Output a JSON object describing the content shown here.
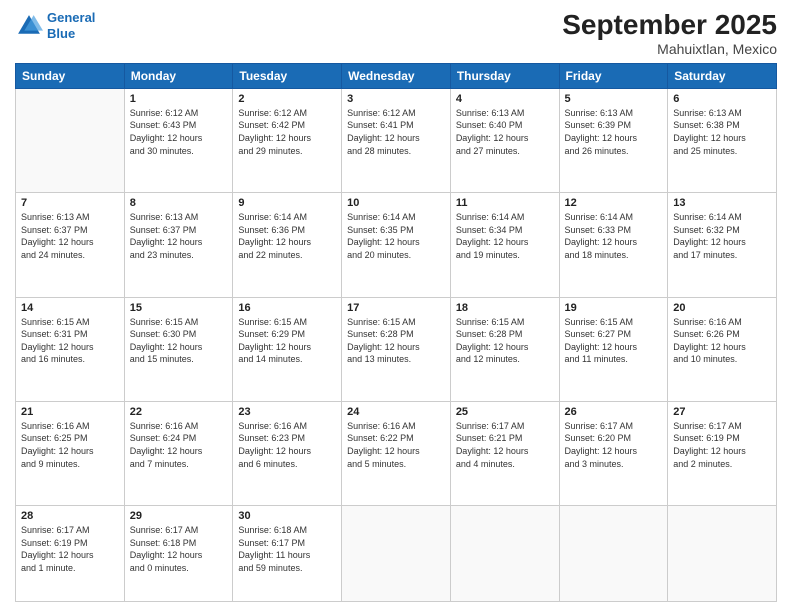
{
  "logo": {
    "line1": "General",
    "line2": "Blue"
  },
  "title": "September 2025",
  "location": "Mahuixtlan, Mexico",
  "days_of_week": [
    "Sunday",
    "Monday",
    "Tuesday",
    "Wednesday",
    "Thursday",
    "Friday",
    "Saturday"
  ],
  "weeks": [
    [
      {
        "day": "",
        "info": ""
      },
      {
        "day": "1",
        "info": "Sunrise: 6:12 AM\nSunset: 6:43 PM\nDaylight: 12 hours\nand 30 minutes."
      },
      {
        "day": "2",
        "info": "Sunrise: 6:12 AM\nSunset: 6:42 PM\nDaylight: 12 hours\nand 29 minutes."
      },
      {
        "day": "3",
        "info": "Sunrise: 6:12 AM\nSunset: 6:41 PM\nDaylight: 12 hours\nand 28 minutes."
      },
      {
        "day": "4",
        "info": "Sunrise: 6:13 AM\nSunset: 6:40 PM\nDaylight: 12 hours\nand 27 minutes."
      },
      {
        "day": "5",
        "info": "Sunrise: 6:13 AM\nSunset: 6:39 PM\nDaylight: 12 hours\nand 26 minutes."
      },
      {
        "day": "6",
        "info": "Sunrise: 6:13 AM\nSunset: 6:38 PM\nDaylight: 12 hours\nand 25 minutes."
      }
    ],
    [
      {
        "day": "7",
        "info": "Sunrise: 6:13 AM\nSunset: 6:37 PM\nDaylight: 12 hours\nand 24 minutes."
      },
      {
        "day": "8",
        "info": "Sunrise: 6:13 AM\nSunset: 6:37 PM\nDaylight: 12 hours\nand 23 minutes."
      },
      {
        "day": "9",
        "info": "Sunrise: 6:14 AM\nSunset: 6:36 PM\nDaylight: 12 hours\nand 22 minutes."
      },
      {
        "day": "10",
        "info": "Sunrise: 6:14 AM\nSunset: 6:35 PM\nDaylight: 12 hours\nand 20 minutes."
      },
      {
        "day": "11",
        "info": "Sunrise: 6:14 AM\nSunset: 6:34 PM\nDaylight: 12 hours\nand 19 minutes."
      },
      {
        "day": "12",
        "info": "Sunrise: 6:14 AM\nSunset: 6:33 PM\nDaylight: 12 hours\nand 18 minutes."
      },
      {
        "day": "13",
        "info": "Sunrise: 6:14 AM\nSunset: 6:32 PM\nDaylight: 12 hours\nand 17 minutes."
      }
    ],
    [
      {
        "day": "14",
        "info": "Sunrise: 6:15 AM\nSunset: 6:31 PM\nDaylight: 12 hours\nand 16 minutes."
      },
      {
        "day": "15",
        "info": "Sunrise: 6:15 AM\nSunset: 6:30 PM\nDaylight: 12 hours\nand 15 minutes."
      },
      {
        "day": "16",
        "info": "Sunrise: 6:15 AM\nSunset: 6:29 PM\nDaylight: 12 hours\nand 14 minutes."
      },
      {
        "day": "17",
        "info": "Sunrise: 6:15 AM\nSunset: 6:28 PM\nDaylight: 12 hours\nand 13 minutes."
      },
      {
        "day": "18",
        "info": "Sunrise: 6:15 AM\nSunset: 6:28 PM\nDaylight: 12 hours\nand 12 minutes."
      },
      {
        "day": "19",
        "info": "Sunrise: 6:15 AM\nSunset: 6:27 PM\nDaylight: 12 hours\nand 11 minutes."
      },
      {
        "day": "20",
        "info": "Sunrise: 6:16 AM\nSunset: 6:26 PM\nDaylight: 12 hours\nand 10 minutes."
      }
    ],
    [
      {
        "day": "21",
        "info": "Sunrise: 6:16 AM\nSunset: 6:25 PM\nDaylight: 12 hours\nand 9 minutes."
      },
      {
        "day": "22",
        "info": "Sunrise: 6:16 AM\nSunset: 6:24 PM\nDaylight: 12 hours\nand 7 minutes."
      },
      {
        "day": "23",
        "info": "Sunrise: 6:16 AM\nSunset: 6:23 PM\nDaylight: 12 hours\nand 6 minutes."
      },
      {
        "day": "24",
        "info": "Sunrise: 6:16 AM\nSunset: 6:22 PM\nDaylight: 12 hours\nand 5 minutes."
      },
      {
        "day": "25",
        "info": "Sunrise: 6:17 AM\nSunset: 6:21 PM\nDaylight: 12 hours\nand 4 minutes."
      },
      {
        "day": "26",
        "info": "Sunrise: 6:17 AM\nSunset: 6:20 PM\nDaylight: 12 hours\nand 3 minutes."
      },
      {
        "day": "27",
        "info": "Sunrise: 6:17 AM\nSunset: 6:19 PM\nDaylight: 12 hours\nand 2 minutes."
      }
    ],
    [
      {
        "day": "28",
        "info": "Sunrise: 6:17 AM\nSunset: 6:19 PM\nDaylight: 12 hours\nand 1 minute."
      },
      {
        "day": "29",
        "info": "Sunrise: 6:17 AM\nSunset: 6:18 PM\nDaylight: 12 hours\nand 0 minutes."
      },
      {
        "day": "30",
        "info": "Sunrise: 6:18 AM\nSunset: 6:17 PM\nDaylight: 11 hours\nand 59 minutes."
      },
      {
        "day": "",
        "info": ""
      },
      {
        "day": "",
        "info": ""
      },
      {
        "day": "",
        "info": ""
      },
      {
        "day": "",
        "info": ""
      }
    ]
  ]
}
